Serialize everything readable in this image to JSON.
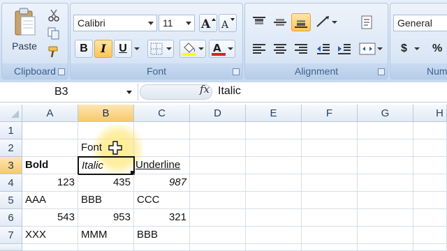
{
  "ribbon": {
    "clipboard": {
      "label": "Clipboard",
      "paste_label": "Paste"
    },
    "font": {
      "label": "Font",
      "font_name": "Calibri",
      "font_size": "11",
      "bold": "B",
      "italic": "I",
      "underline": "U",
      "italic_active": true
    },
    "alignment": {
      "label": "Alignment"
    },
    "number": {
      "label": "Numb",
      "format": "General",
      "currency": "$",
      "percent": "%"
    }
  },
  "formula_bar": {
    "name_box": "B3",
    "fx": "fx",
    "content": "Italic"
  },
  "grid": {
    "columns": [
      "A",
      "B",
      "C",
      "D",
      "E",
      "F",
      "G",
      "H"
    ],
    "rows": [
      "1",
      "2",
      "3",
      "4",
      "5",
      "6",
      "7"
    ],
    "selected_column": "B",
    "selected_row": "3",
    "active_cell": "B3",
    "cells": {
      "B2": "Font",
      "A3": "Bold",
      "B3": "Italic",
      "C3": "Underline",
      "A4": "123",
      "B4": "435",
      "C4": "987",
      "A5": "AAA",
      "B5": "BBB",
      "C5": "CCC",
      "A6": "543",
      "B6": "953",
      "C6": "321",
      "A7": "XXX",
      "B7": "MMM",
      "C7": "BBB"
    }
  },
  "colors": {
    "selection_header": "#f7c96b",
    "active_button": "#ffc457",
    "ribbon_label": "#3e5f8d"
  }
}
